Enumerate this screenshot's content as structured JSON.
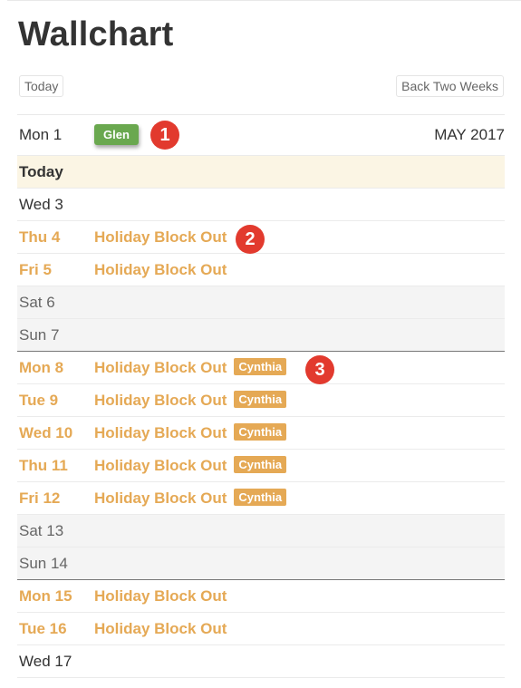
{
  "page": {
    "title": "Wallchart"
  },
  "toolbar": {
    "today_label": "Today",
    "back_label": "Back Two Weeks"
  },
  "header_row": {
    "day": "Mon 1",
    "assignee": "Glen",
    "month": "MAY 2017"
  },
  "markers": [
    "1",
    "2",
    "3"
  ],
  "rows": [
    {
      "day": "Today",
      "event": "",
      "tag": "",
      "type": "today"
    },
    {
      "day": "Wed 3",
      "event": "",
      "tag": "",
      "type": "normal"
    },
    {
      "day": "Thu 4",
      "event": "Holiday Block Out",
      "tag": "",
      "type": "holiday"
    },
    {
      "day": "Fri 5",
      "event": "Holiday Block Out",
      "tag": "",
      "type": "holiday"
    },
    {
      "day": "Sat 6",
      "event": "",
      "tag": "",
      "type": "weekend"
    },
    {
      "day": "Sun 7",
      "event": "",
      "tag": "",
      "type": "weekend-end"
    },
    {
      "day": "Mon 8",
      "event": "Holiday Block Out",
      "tag": "Cynthia",
      "type": "holiday"
    },
    {
      "day": "Tue 9",
      "event": "Holiday Block Out",
      "tag": "Cynthia",
      "type": "holiday"
    },
    {
      "day": "Wed 10",
      "event": "Holiday Block Out",
      "tag": "Cynthia",
      "type": "holiday"
    },
    {
      "day": "Thu 11",
      "event": "Holiday Block Out",
      "tag": "Cynthia",
      "type": "holiday"
    },
    {
      "day": "Fri 12",
      "event": "Holiday Block Out",
      "tag": "Cynthia",
      "type": "holiday"
    },
    {
      "day": "Sat 13",
      "event": "",
      "tag": "",
      "type": "weekend"
    },
    {
      "day": "Sun 14",
      "event": "",
      "tag": "",
      "type": "weekend-end"
    },
    {
      "day": "Mon 15",
      "event": "Holiday Block Out",
      "tag": "",
      "type": "holiday"
    },
    {
      "day": "Tue 16",
      "event": "Holiday Block Out",
      "tag": "",
      "type": "holiday"
    },
    {
      "day": "Wed 17",
      "event": "",
      "tag": "",
      "type": "normal"
    }
  ],
  "colors": {
    "holiday": "#e5a955",
    "assignee_green": "#6aa84f",
    "marker_red": "#e23a2e",
    "today_bg": "#fbf5e4",
    "weekend_bg": "#f4f4f4"
  }
}
